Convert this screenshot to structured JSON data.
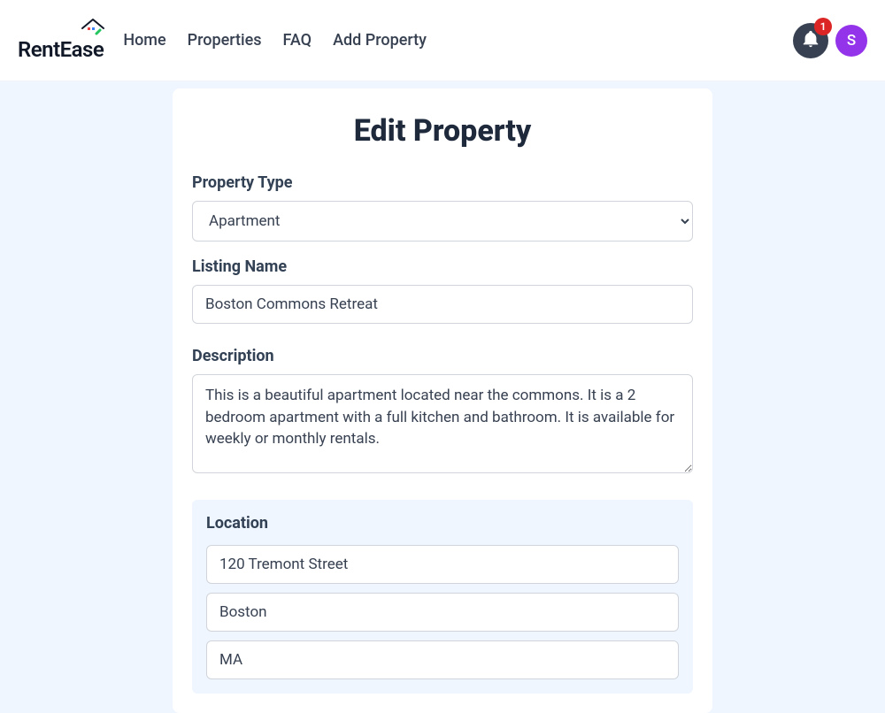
{
  "brand": {
    "name": "RentEase"
  },
  "nav": {
    "links": [
      "Home",
      "Properties",
      "FAQ",
      "Add Property"
    ]
  },
  "notifications": {
    "count": "1"
  },
  "user": {
    "initial": "S"
  },
  "page": {
    "title": "Edit Property"
  },
  "form": {
    "property_type": {
      "label": "Property Type",
      "value": "Apartment"
    },
    "listing_name": {
      "label": "Listing Name",
      "value": "Boston Commons Retreat"
    },
    "description": {
      "label": "Description",
      "value": "This is a beautiful apartment located near the commons. It is a 2 bedroom apartment with a full kitchen and bathroom. It is available for weekly or monthly rentals."
    },
    "location": {
      "label": "Location",
      "street": "120 Tremont Street",
      "city": "Boston",
      "state": "MA"
    }
  }
}
